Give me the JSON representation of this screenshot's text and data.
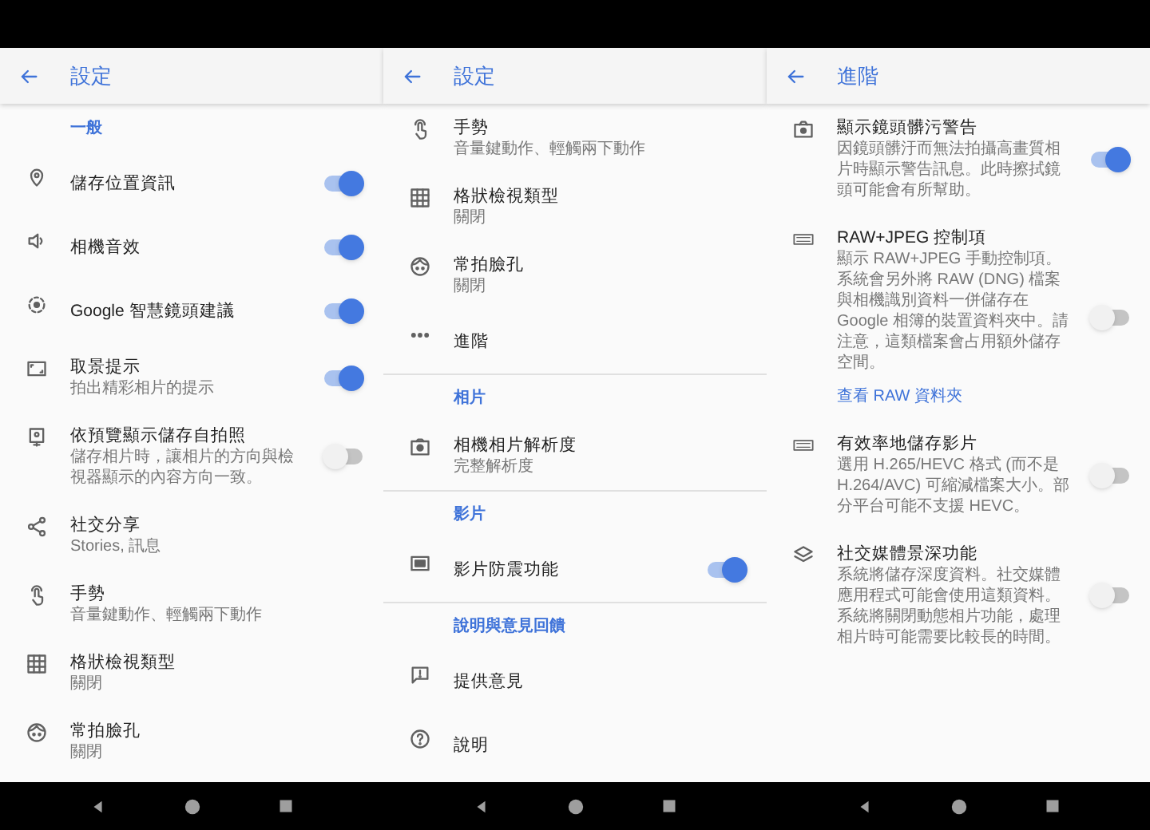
{
  "panels": [
    {
      "title": "設定",
      "items": [
        {
          "kind": "section",
          "label": "一般"
        },
        {
          "kind": "setting",
          "title": "儲存位置資訊",
          "on": true
        },
        {
          "kind": "setting",
          "title": "相機音效",
          "on": true
        },
        {
          "kind": "setting",
          "title": "Google 智慧鏡頭建議",
          "on": true
        },
        {
          "kind": "setting",
          "title": "取景提示",
          "subtitle": "拍出精彩相片的提示",
          "on": true
        },
        {
          "kind": "setting",
          "title": "依預覽顯示儲存自拍照",
          "subtitle": "儲存相片時，讓相片的方向與檢視器顯示的內容方向一致。",
          "on": false
        },
        {
          "kind": "setting",
          "title": "社交分享",
          "subtitle": "Stories, 訊息"
        },
        {
          "kind": "setting",
          "title": "手勢",
          "subtitle": "音量鍵動作、輕觸兩下動作"
        },
        {
          "kind": "setting",
          "title": "格狀檢視類型",
          "subtitle": "關閉"
        },
        {
          "kind": "setting",
          "title": "常拍臉孔",
          "subtitle": "關閉"
        }
      ]
    },
    {
      "title": "設定",
      "items": [
        {
          "kind": "setting",
          "title": "手勢",
          "subtitle": "音量鍵動作、輕觸兩下動作"
        },
        {
          "kind": "setting",
          "title": "格狀檢視類型",
          "subtitle": "關閉"
        },
        {
          "kind": "setting",
          "title": "常拍臉孔",
          "subtitle": "關閉"
        },
        {
          "kind": "setting",
          "title": "進階"
        },
        {
          "kind": "section",
          "label": "相片"
        },
        {
          "kind": "setting",
          "title": "相機相片解析度",
          "subtitle": "完整解析度"
        },
        {
          "kind": "section",
          "label": "影片"
        },
        {
          "kind": "setting",
          "title": "影片防震功能",
          "on": true
        },
        {
          "kind": "section",
          "label": "說明與意見回饋"
        },
        {
          "kind": "setting",
          "title": "提供意見"
        },
        {
          "kind": "setting",
          "title": "說明"
        }
      ]
    },
    {
      "title": "進階",
      "items": [
        {
          "kind": "setting",
          "title": "顯示鏡頭髒污警告",
          "subtitle": "因鏡頭髒汙而無法拍攝高畫質相片時顯示警告訊息。此時擦拭鏡頭可能會有所幫助。",
          "on": true
        },
        {
          "kind": "setting",
          "title": "RAW+JPEG 控制項",
          "subtitle": "顯示 RAW+JPEG 手動控制項。系統會另外將 RAW (DNG) 檔案與相機識別資料一併儲存在 Google 相簿的裝置資料夾中。請注意，這類檔案會占用額外儲存空間。",
          "link": "查看 RAW 資料夾",
          "on": false
        },
        {
          "kind": "setting",
          "title": "有效率地儲存影片",
          "subtitle": "選用 H.265/HEVC 格式 (而不是 H.264/AVC) 可縮減檔案大小。部分平台可能不支援 HEVC。",
          "on": false
        },
        {
          "kind": "setting",
          "title": "社交媒體景深功能",
          "subtitle": "系統將儲存深度資料。社交媒體應用程式可能會使用這類資料。系統將關閉動態相片功能，處理相片時可能需要比較長的時間。",
          "on": false
        }
      ]
    }
  ]
}
